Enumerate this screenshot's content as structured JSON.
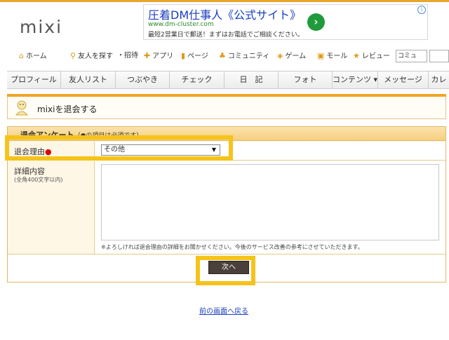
{
  "app": {
    "logo": "mixi"
  },
  "ad": {
    "title": "圧着DM仕事人《公式サイト》",
    "url": "www.dm-cluster.com",
    "description": "最短2営業日で郵送！まずはお電話でご相談ください。",
    "arrow_icon": "chevron-right-icon",
    "info_icon": "info-icon"
  },
  "main_nav": {
    "items": [
      {
        "label": "ホーム",
        "icon": "home-icon"
      },
      {
        "label": "友人を探す",
        "icon": "search-icon"
      },
      {
        "label": "招待",
        "icon": ""
      },
      {
        "label": "アプリ",
        "icon": "puzzle-icon"
      },
      {
        "label": "ページ",
        "icon": "bookmark-icon"
      },
      {
        "label": "コミュニティ",
        "icon": "people-icon"
      },
      {
        "label": "ゲーム",
        "icon": "gamepad-icon"
      },
      {
        "label": "モール",
        "icon": "shopping-bag-icon"
      },
      {
        "label": "レビュー",
        "icon": "star-icon"
      }
    ],
    "search_scope": "コミュ"
  },
  "tabs": [
    {
      "label": "プロフィール"
    },
    {
      "label": "友人リスト"
    },
    {
      "label": "つぶやき"
    },
    {
      "label": "チェック"
    },
    {
      "label": "日　記"
    },
    {
      "label": "フォト"
    },
    {
      "label": "コンテンツ ▾"
    },
    {
      "label": "メッセージ"
    },
    {
      "label": "カレ"
    }
  ],
  "page": {
    "title": "mixiを退会する"
  },
  "form": {
    "section_title": "退会アンケート",
    "section_note": "（●の項目は必須です）",
    "reason_label": "退会理由",
    "required_mark": "●",
    "reason_value": "その他",
    "detail_label": "詳細内容",
    "detail_sub": "(全角400文字以内)",
    "detail_value": "",
    "detail_note": "※よろしければ退会理由の詳細をお聞かせください。今後のサービス改善の参考にさせていただきます。",
    "next_button": "次へ"
  },
  "back_link": "前の画面へ戻る",
  "colors": {
    "accent": "#f0a524",
    "highlight": "#f5c31a",
    "button": "#4a4039",
    "link": "#1a3fbd"
  }
}
